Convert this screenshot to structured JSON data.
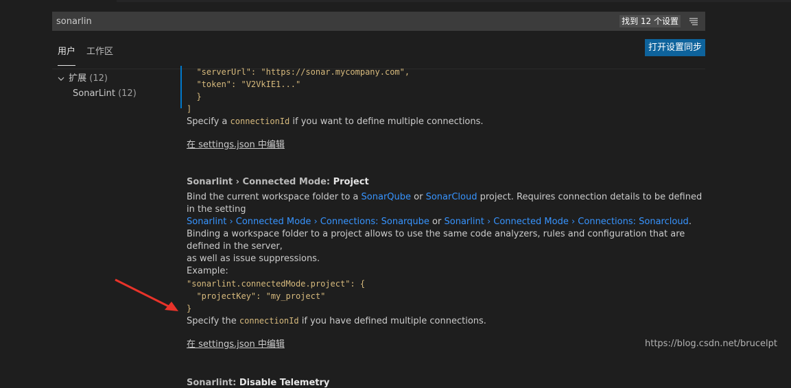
{
  "search": {
    "value": "sonarlin",
    "result_count": "找到 12 个设置"
  },
  "tabs": {
    "user": "用户",
    "workspace": "工作区",
    "sync_button": "打开设置同步"
  },
  "toc": [
    {
      "label": "扩展",
      "count": "(12)"
    },
    {
      "label": "SonarLint",
      "count": "(12)"
    }
  ],
  "prev_setting": {
    "code_lines": [
      "  \"serverUrl\": \"https://sonar.mycompany.com\",",
      "  \"token\": \"V2VkIE1...\"",
      "  }",
      "]"
    ],
    "note_before": "Specify a ",
    "note_code": "connectionId",
    "note_after": " if you want to define multiple connections.",
    "edit_link": "在 settings.json 中编辑"
  },
  "project_setting": {
    "title_category": "Sonarlint › Connected Mode: ",
    "title_name": "Project",
    "desc1_a": "Bind the current workspace folder to a ",
    "desc1_link1": "SonarQube",
    "desc1_b": " or ",
    "desc1_link2": "SonarCloud",
    "desc1_c": " project. Requires connection details to be defined in the setting",
    "desc2_link1": "Sonarlint › Connected Mode › Connections: Sonarqube",
    "desc2_b": " or ",
    "desc2_link2": "Sonarlint › Connected Mode › Connections: Sonarcloud",
    "desc2_c": ".",
    "desc3": "Binding a workspace folder to a project allows to use the same code analyzers, rules and configuration that are defined in the server,",
    "desc4": "as well as issue suppressions.",
    "example_label": "Example:",
    "code_lines": [
      "\"sonarlint.connectedMode.project\": {",
      "  \"projectKey\": \"my_project\"",
      "}"
    ],
    "note_before": "Specify the ",
    "note_code": "connectionId",
    "note_after": " if you have defined multiple connections.",
    "edit_link": "在 settings.json 中编辑"
  },
  "telemetry_setting": {
    "title_category": "Sonarlint: ",
    "title_name": "Disable Telemetry"
  },
  "watermark": "https://blog.csdn.net/brucelpt",
  "colors": {
    "accent": "#0e639c",
    "link": "#3794ff",
    "code": "#d7ba7d",
    "annotation_arrow": "#e8332a"
  }
}
